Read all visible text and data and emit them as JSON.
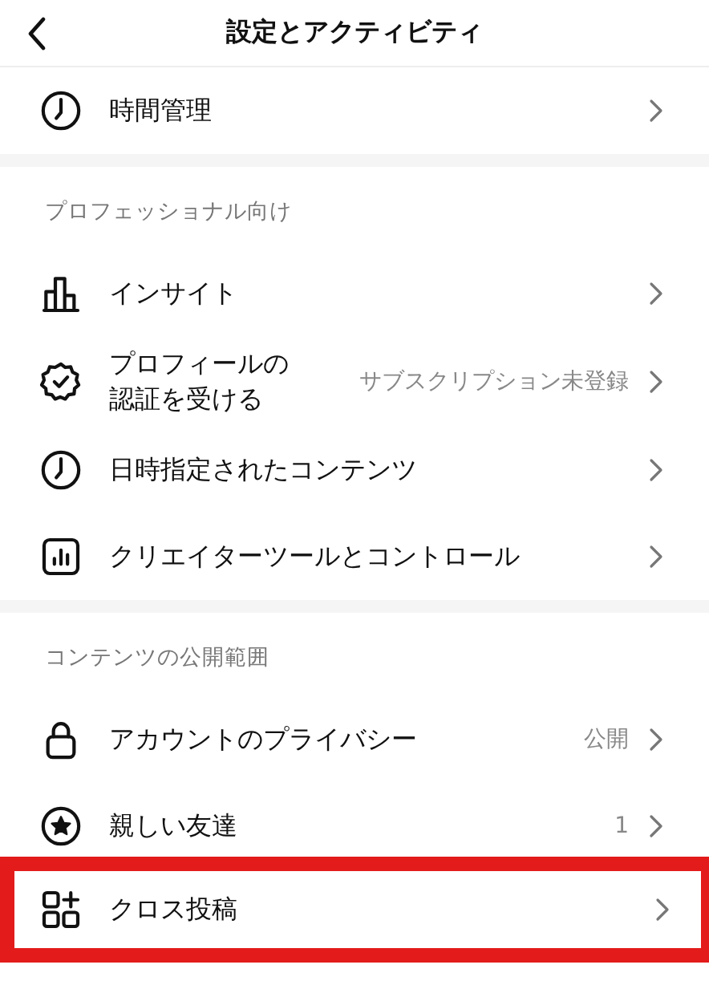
{
  "header": {
    "title": "設定とアクティビティ"
  },
  "sections": [
    {
      "items": [
        {
          "kind": "clock",
          "label": "時間管理",
          "highlighted": false
        }
      ]
    },
    {
      "title": "プロフェッショナル向け",
      "items": [
        {
          "kind": "bars",
          "label": "インサイト",
          "highlighted": false
        },
        {
          "kind": "badge",
          "label": "プロフィールの認証を受ける",
          "value": "サブスクリプション未登録",
          "highlighted": false
        },
        {
          "kind": "clock",
          "label": "日時指定されたコンテンツ",
          "highlighted": false
        },
        {
          "kind": "chart",
          "label": "クリエイターツールとコントロール",
          "highlighted": false
        }
      ]
    },
    {
      "title": "コンテンツの公開範囲",
      "items": [
        {
          "kind": "lock",
          "label": "アカウントのプライバシー",
          "value": "公開",
          "highlighted": false
        },
        {
          "kind": "star",
          "label": "親しい友達",
          "value": "1",
          "highlighted": false
        },
        {
          "kind": "grid",
          "label": "クロス投稿",
          "highlighted": true
        }
      ]
    }
  ]
}
